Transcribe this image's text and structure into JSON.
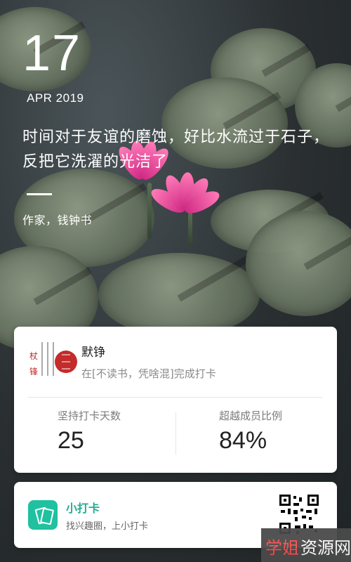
{
  "date": {
    "day": "17",
    "month_year": "APR 2019"
  },
  "quote": {
    "text": "时间对于友谊的磨蚀，好比水流过于石子，反把它洗濯的光洁了",
    "author": "作家，钱钟书"
  },
  "card": {
    "user_name": "默铮",
    "activity": "在[不读书，凭啥混]完成打卡",
    "stats": [
      {
        "label": "坚持打卡天数",
        "value": "25"
      },
      {
        "label": "超越成员比例",
        "value": "84%"
      }
    ],
    "avatar_icon": "calligraphy-seal-icon"
  },
  "footer": {
    "app_name": "小打卡",
    "tagline": "找兴趣圈，上小打卡",
    "app_icon": "cards-icon",
    "qr_icon": "qr-code-icon"
  },
  "watermark": {
    "part1": "学姐",
    "part2": "资源网"
  },
  "colors": {
    "accent": "#1fc1a0",
    "seal_red": "#c42b2b",
    "lotus_pink": "#e0479b"
  }
}
